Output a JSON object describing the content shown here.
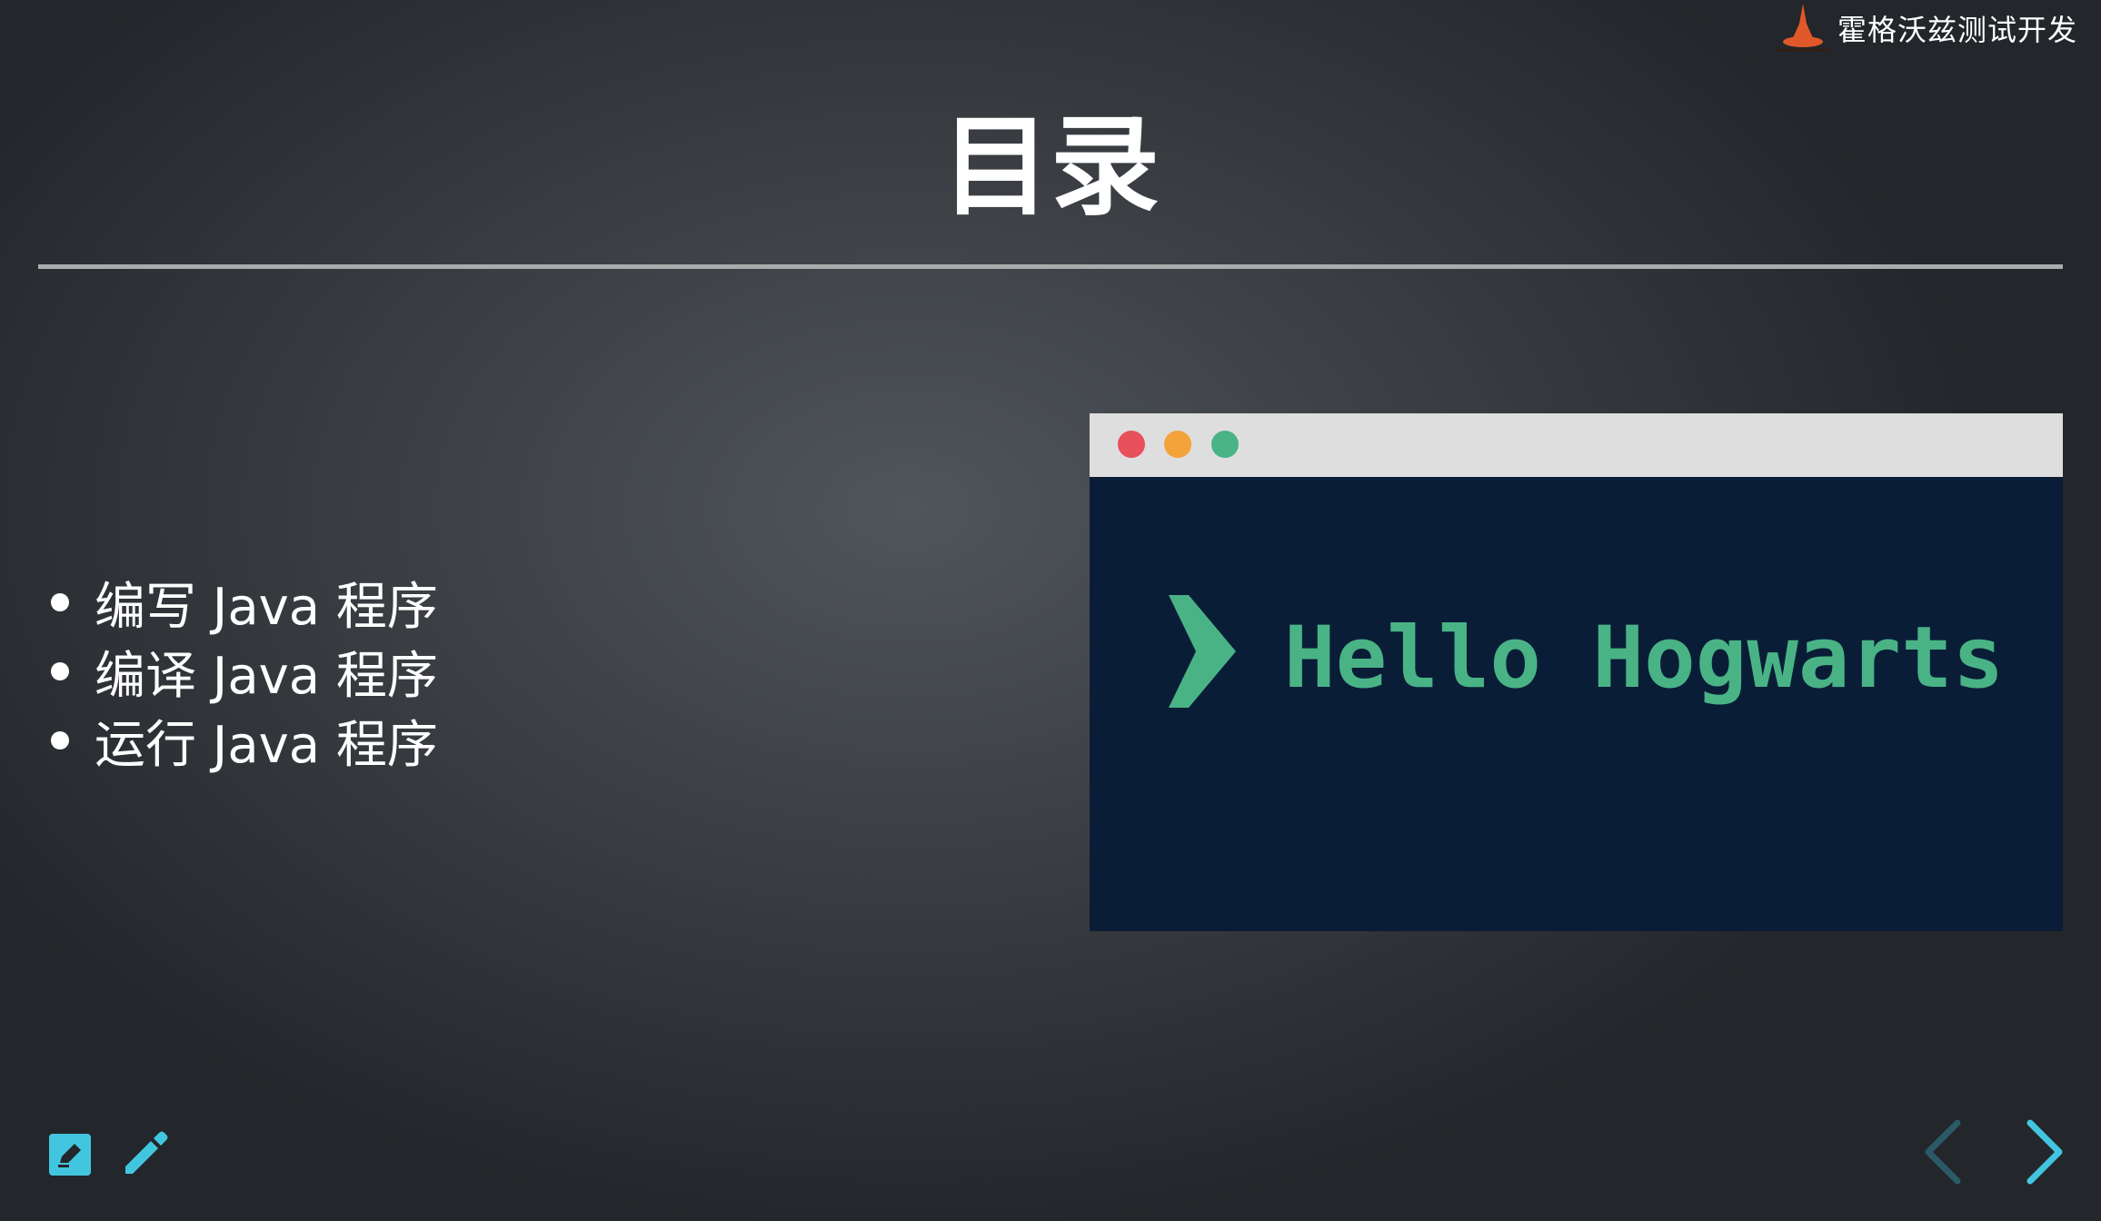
{
  "brand": {
    "name": "霍格沃兹测试开发",
    "logo_icon": "wizard-hat-logo-icon"
  },
  "slide": {
    "title": "目录",
    "items": [
      {
        "label": "编写 Java 程序"
      },
      {
        "label": "编译 Java 程序"
      },
      {
        "label": "运行 Java 程序"
      }
    ]
  },
  "terminal": {
    "text": "Hello Hogwarts",
    "prompt_icon": "chevron-prompt-icon",
    "colors": {
      "bar": "#dedede",
      "body": "#0a1d37",
      "text": "#49b386",
      "close_dot": "#e8505b",
      "minimize_dot": "#f4a23a",
      "maximize_dot": "#49b386"
    }
  },
  "controls": {
    "notes_icon": "edit-note-icon",
    "pen_icon": "pencil-icon",
    "prev_icon": "chevron-left-icon",
    "next_icon": "chevron-right-icon",
    "accent": "#42c6e0"
  }
}
